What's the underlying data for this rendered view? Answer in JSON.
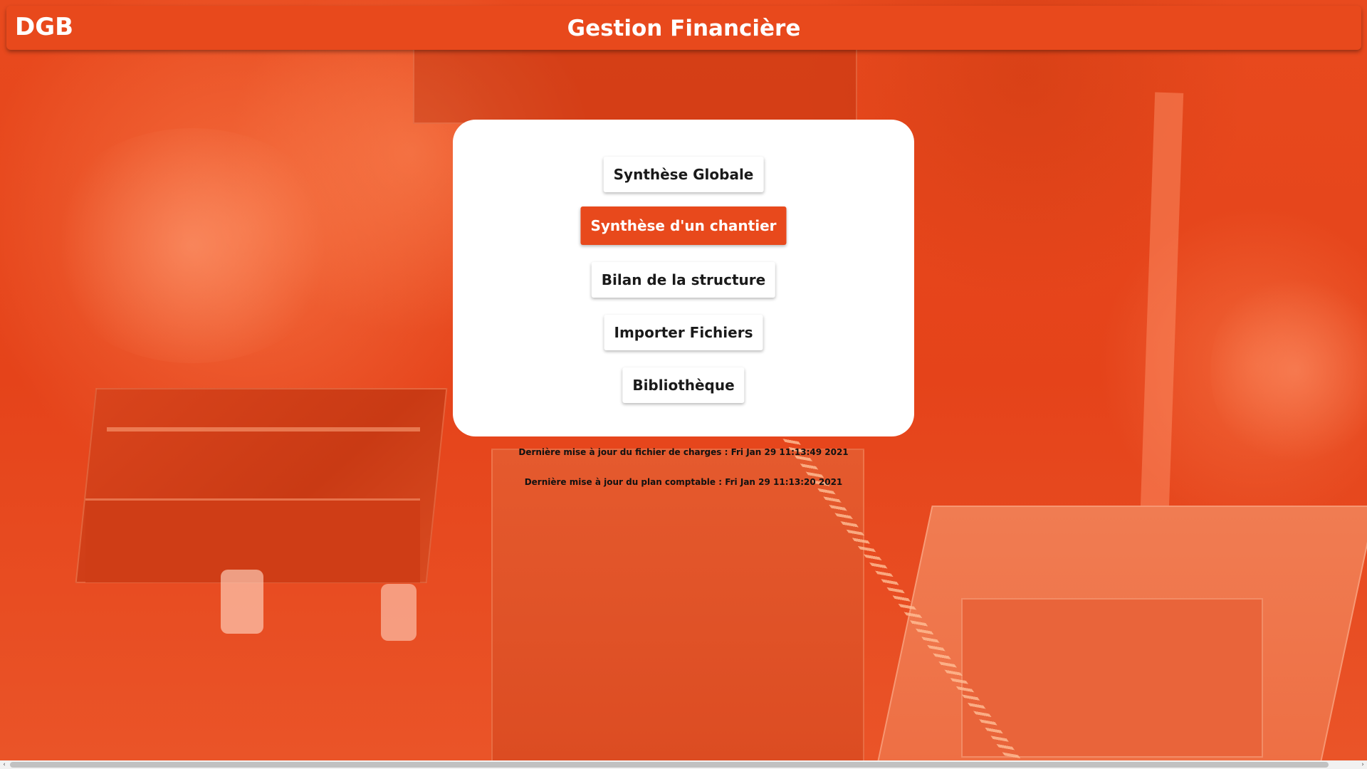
{
  "header": {
    "logo": "DGB",
    "title": "Gestion Financière"
  },
  "menu": {
    "items": [
      {
        "label": "Synthèse Globale",
        "active": false
      },
      {
        "label": "Synthèse d'un chantier",
        "active": true
      },
      {
        "label": "Bilan de la structure",
        "active": false
      },
      {
        "label": "Importer Fichiers",
        "active": false
      },
      {
        "label": "Bibliothèque",
        "active": false
      }
    ]
  },
  "updates": {
    "charges": "Dernière mise à jour du fichier de charges : Fri Jan 29 11:13:49 2021",
    "plan": "Dernière mise à jour du plan comptable : Fri Jan 29 11:13:20 2021"
  },
  "scrollbar": {
    "left_arrow": "‹",
    "right_arrow": "›"
  },
  "colors": {
    "brand": "#e8491c",
    "card": "#ffffff",
    "text": "#1a1a1a"
  }
}
